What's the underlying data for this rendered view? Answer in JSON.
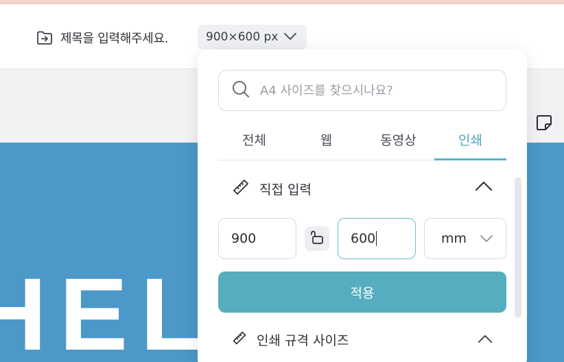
{
  "header": {
    "title": "제목을 입력해주세요.",
    "size_label": "900×600 px"
  },
  "canvas": {
    "big_text": "HEL",
    "artboard_color": "#4b98c9"
  },
  "panel": {
    "search": {
      "placeholder": "A4 사이즈를 찾으시나요?"
    },
    "tabs": [
      {
        "label": "전체"
      },
      {
        "label": "웹"
      },
      {
        "label": "동영상"
      },
      {
        "label": "인쇄",
        "active": true
      }
    ],
    "custom_section": {
      "title": "직접 입력",
      "width_value": "900",
      "height_value": "600",
      "unit": "mm",
      "apply_label": "적용"
    },
    "print_section": {
      "title": "인쇄 규격 사이즈"
    }
  },
  "colors": {
    "accent": "#55adbf",
    "tab_active": "#4aa5c0"
  }
}
